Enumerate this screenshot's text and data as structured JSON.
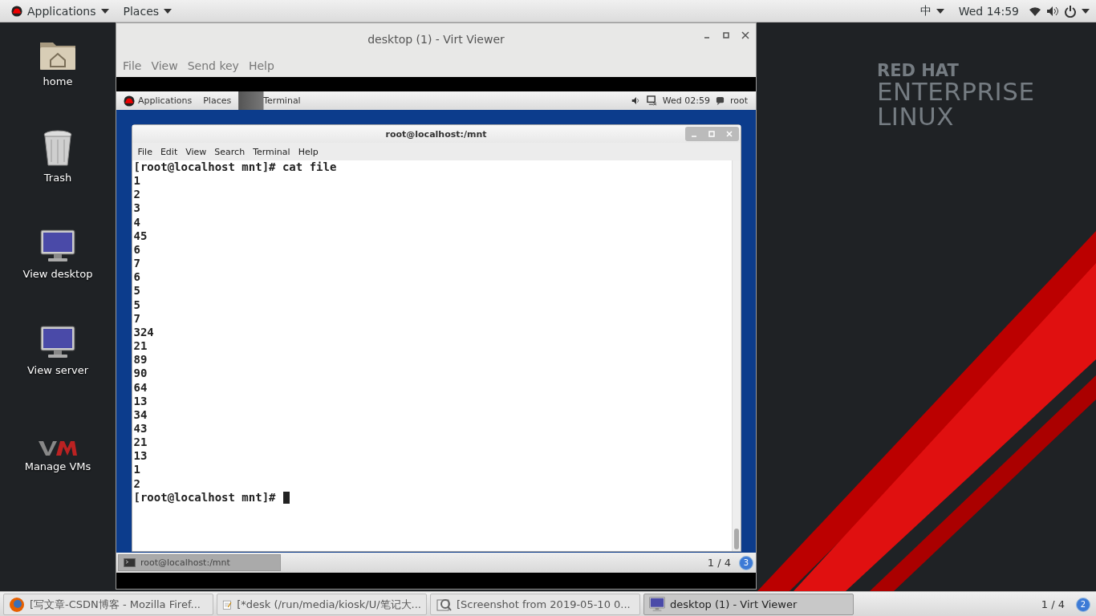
{
  "top_bar": {
    "menus": [
      "Applications",
      "Places"
    ],
    "input_method": "中",
    "clock": "Wed 14:59"
  },
  "desktop_icons": [
    {
      "kind": "home",
      "label": "home"
    },
    {
      "kind": "trash",
      "label": "Trash"
    },
    {
      "kind": "monitor",
      "label": "View desktop"
    },
    {
      "kind": "monitor",
      "label": "View server"
    },
    {
      "kind": "vm",
      "label": "Manage VMs"
    }
  ],
  "logo": {
    "line_1": "RED HAT",
    "line_2": "ENTERPRISE",
    "line_3": "LINUX"
  },
  "viewer": {
    "title": "desktop (1) - Virt Viewer",
    "menu": [
      "File",
      "View",
      "Send key",
      "Help"
    ],
    "guest_top_bar": {
      "menus": [
        "Applications",
        "Places"
      ],
      "active_app": "Terminal",
      "clock": "Wed 02:59",
      "user": "root"
    },
    "terminal": {
      "title": "root@localhost:/mnt",
      "menu": [
        "File",
        "Edit",
        "View",
        "Search",
        "Terminal",
        "Help"
      ],
      "lines": [
        "[root@localhost mnt]# cat file",
        "1",
        "2",
        "3",
        "4",
        "45",
        "6",
        "7",
        "6",
        "5",
        "5",
        "7",
        "324",
        "21",
        "89",
        "90",
        "64",
        "13",
        "34",
        "43",
        "21",
        "13",
        "1",
        "2"
      ],
      "prompt": "[root@localhost mnt]#"
    },
    "guest_task": "root@localhost:/mnt",
    "guest_workspace": "1 / 4",
    "guest_badge": "3"
  },
  "taskbar": {
    "tasks": [
      {
        "kind": "firefox",
        "label": "[写文章-CSDN博客 - Mozilla Firef...",
        "selected": false
      },
      {
        "kind": "editor",
        "label": "[*desk (/run/media/kiosk/U/笔记大...",
        "selected": false
      },
      {
        "kind": "screenshot",
        "label": "[Screenshot from 2019-05-10 0...",
        "selected": false
      },
      {
        "kind": "monitor",
        "label": "desktop (1) - Virt Viewer",
        "selected": true
      }
    ],
    "workspace": "1 / 4",
    "badge": "2"
  }
}
